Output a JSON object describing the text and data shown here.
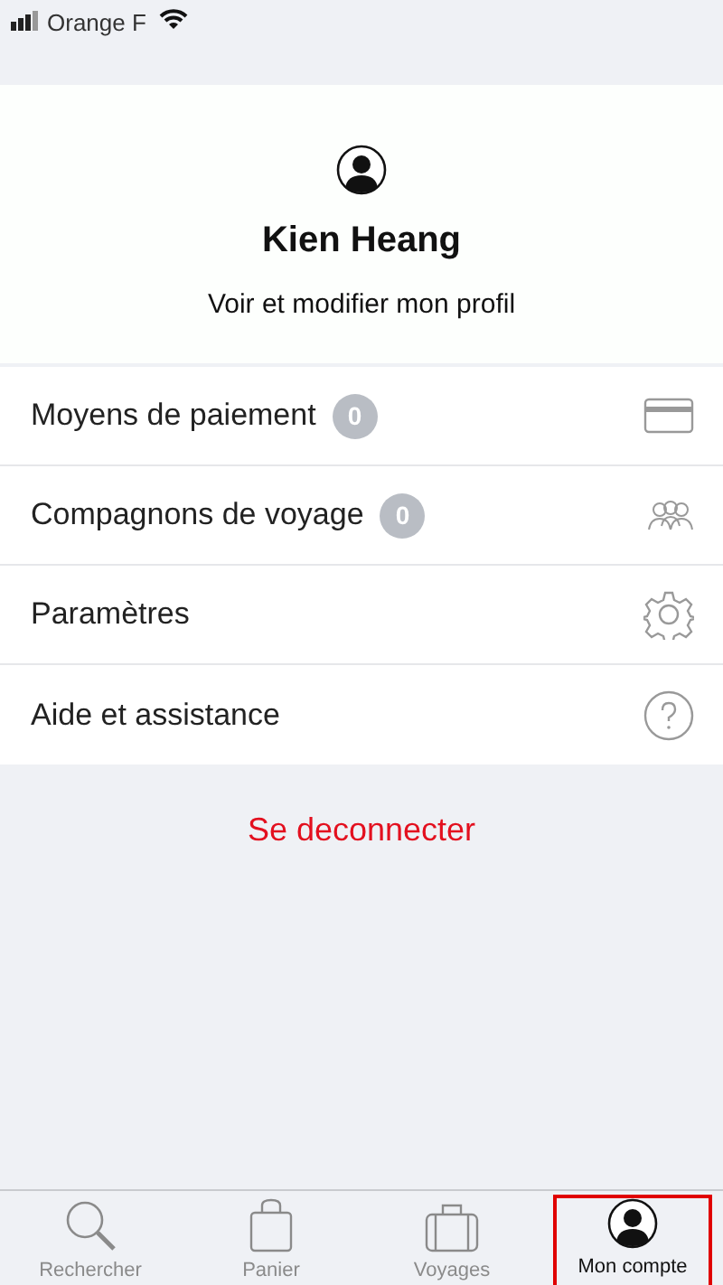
{
  "status_bar": {
    "carrier": "Orange F"
  },
  "profile": {
    "name": "Kien Heang",
    "link": "Voir et modifier mon profil"
  },
  "menu_items": [
    {
      "label": "Moyens de paiement",
      "badge": "0",
      "kind": "card"
    },
    {
      "label": "Compagnons de voyage",
      "badge": "0",
      "kind": "people"
    },
    {
      "label": "Paramètres",
      "kind": "gear"
    },
    {
      "label": "Aide et assistance",
      "kind": "help"
    }
  ],
  "logout": "Se deconnecter",
  "tab_bar": [
    {
      "label": "Rechercher",
      "kind": "search",
      "selected": false
    },
    {
      "label": "Panier",
      "kind": "bag",
      "selected": false
    },
    {
      "label": "Voyages",
      "kind": "suitcase",
      "selected": false
    },
    {
      "label": "Mon compte",
      "kind": "account",
      "selected": true
    }
  ]
}
